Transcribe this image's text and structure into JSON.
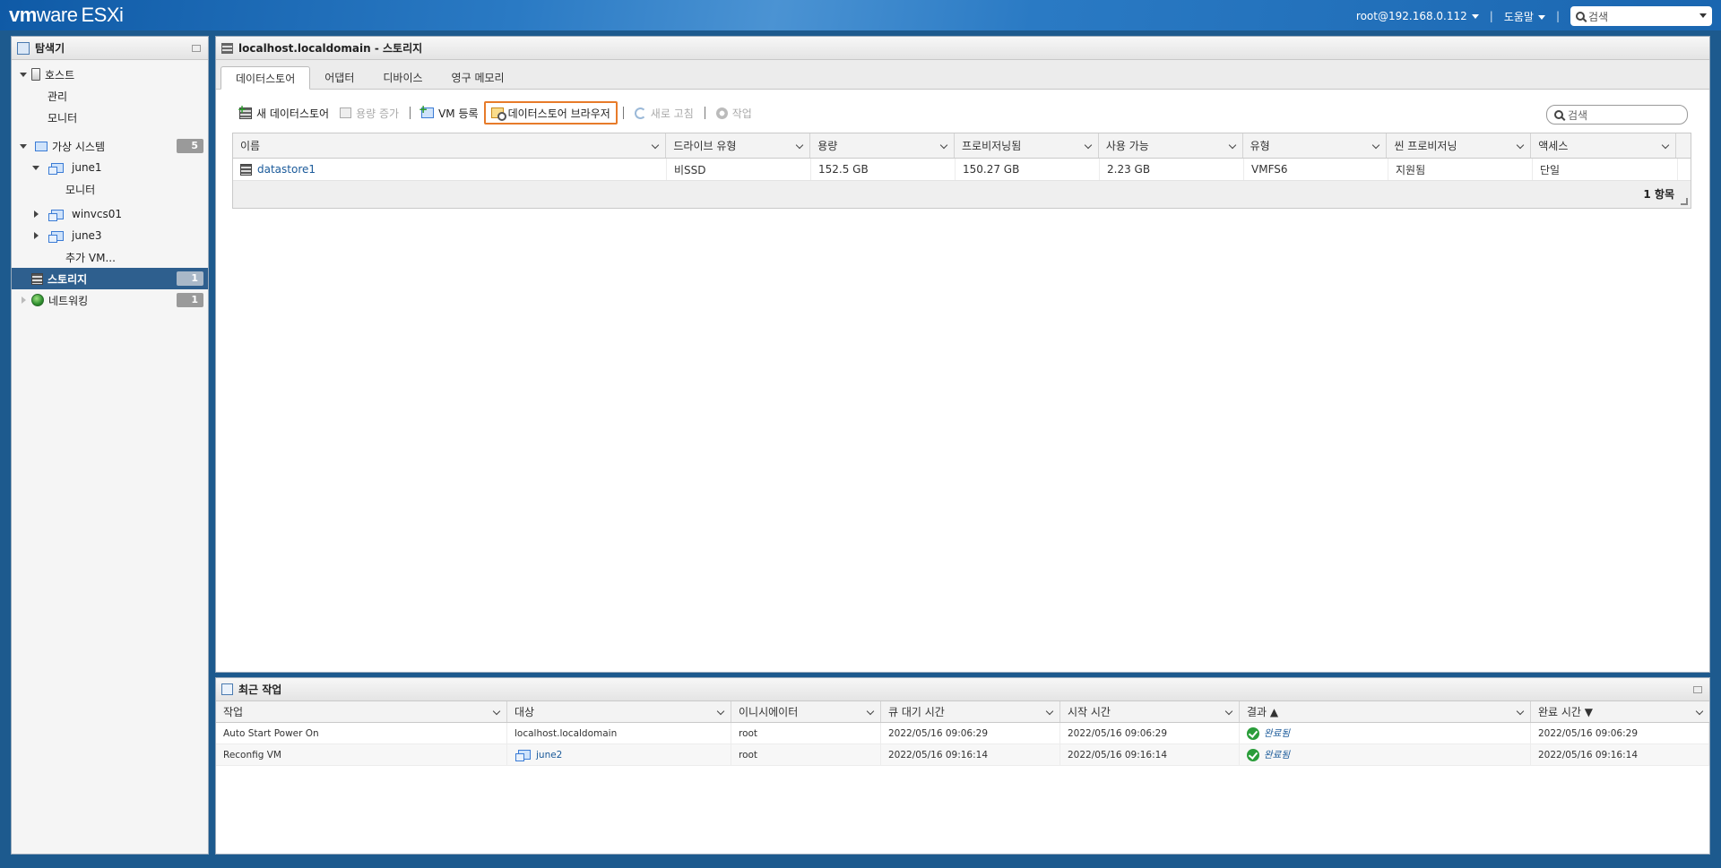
{
  "header": {
    "brand_vm": "vm",
    "brand_ware": "ware",
    "brand_product": "ESXi",
    "user": "root@192.168.0.112",
    "help": "도움말",
    "search_placeholder": "검색"
  },
  "navigator": {
    "title": "탐색기",
    "host": "호스트",
    "host_manage": "관리",
    "host_monitor": "모니터",
    "vms_label": "가상 시스템",
    "vms_count": "5",
    "vm1": "june1",
    "vm1_monitor": "모니터",
    "vm2": "winvcs01",
    "vm3": "june3",
    "more_vms": "추가 VM...",
    "storage": "스토리지",
    "storage_count": "1",
    "networking": "네트워킹",
    "networking_count": "1"
  },
  "main": {
    "title": "localhost.localdomain - 스토리지",
    "tabs": [
      "데이터스토어",
      "어댑터",
      "디바이스",
      "영구 메모리"
    ],
    "toolbar": {
      "new_datastore": "새 데이터스토어",
      "increase_capacity": "용량 증가",
      "register_vm": "VM 등록",
      "datastore_browser": "데이터스토어 브라우저",
      "refresh": "새로 고침",
      "actions": "작업"
    },
    "search_placeholder": "검색",
    "columns": [
      "이름",
      "드라이브 유형",
      "용량",
      "프로비저닝됨",
      "사용 가능",
      "유형",
      "씬 프로비저닝",
      "액세스"
    ],
    "rows": [
      [
        "datastore1",
        "비SSD",
        "152.5 GB",
        "150.27 GB",
        "2.23 GB",
        "VMFS6",
        "지원됨",
        "단일"
      ]
    ],
    "footer": "1 항목"
  },
  "tasks": {
    "title": "최근 작업",
    "columns": [
      "작업",
      "대상",
      "이니시에이터",
      "큐 대기 시간",
      "시작 시간",
      "결과 ▲",
      "완료 시간 ▼"
    ],
    "rows": [
      {
        "task": "Auto Start Power On",
        "target": "localhost.localdomain",
        "initiator": "root",
        "queued": "2022/05/16 09:06:29",
        "started": "2022/05/16 09:06:29",
        "result": "완료됨",
        "completed": "2022/05/16 09:06:29"
      },
      {
        "task": "Reconfig VM",
        "target": "june2",
        "initiator": "root",
        "queued": "2022/05/16 09:16:14",
        "started": "2022/05/16 09:16:14",
        "result": "완료됨",
        "completed": "2022/05/16 09:16:14"
      }
    ]
  },
  "colors": {
    "header_blue": "#1a66b0",
    "selected_nav": "#2e5f8e",
    "highlight_border": "#e77b2a",
    "success_green": "#2a9d3a"
  }
}
